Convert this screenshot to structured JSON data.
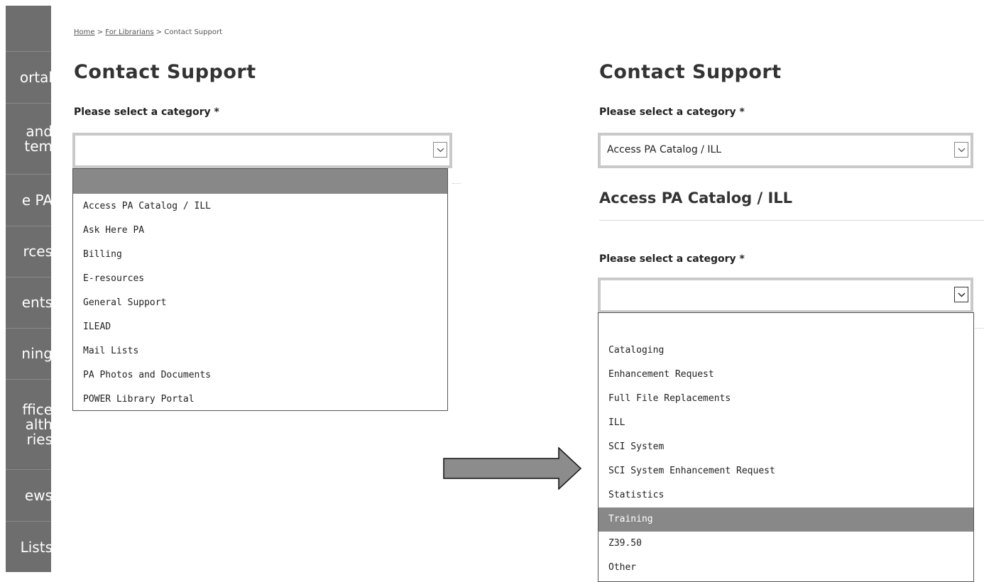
{
  "sidebar": {
    "items": [
      {
        "label": "ortal"
      },
      {
        "label": " and\ntem"
      },
      {
        "label": "e PA"
      },
      {
        "label": "rces"
      },
      {
        "label": "ents"
      },
      {
        "label": "ning"
      },
      {
        "label": "ffice\nalth\nries"
      },
      {
        "label": "ews"
      },
      {
        "label": "Lists"
      }
    ]
  },
  "left_panel": {
    "breadcrumb": {
      "home": "Home",
      "sep1": ">",
      "librarians": "For Librarians",
      "sep2": ">",
      "current": "Contact Support"
    },
    "title": "Contact Support",
    "category_label": "Please select a category *",
    "select_value": "",
    "options": [
      "",
      "Access PA Catalog / ILL",
      "Ask Here PA",
      "Billing",
      "E-resources",
      "General Support",
      "ILEAD",
      "Mail Lists",
      "PA Photos and Documents",
      "POWER Library Portal"
    ],
    "highlighted_option": ""
  },
  "right_panel": {
    "title": "Contact Support",
    "category_label": "Please select a category *",
    "select_value": "Access PA Catalog / ILL",
    "section_heading": "Access PA Catalog / ILL",
    "subcategory_label": "Please select a category *",
    "subselect_value": "",
    "sub_options": [
      "",
      "Cataloging",
      "Enhancement Request",
      "Full File Replacements",
      "ILL",
      "SCI System",
      "SCI System Enhancement Request",
      "Statistics",
      "Training",
      "Z39.50",
      "Other"
    ],
    "highlighted_option": "Training"
  },
  "arrow": {
    "direction": "right",
    "fill": "#8c8c8c"
  },
  "colors": {
    "sidebar_bg": "#6e6e6e",
    "highlight": "#888888",
    "select_border": "#c9c9c9"
  },
  "icons": {
    "select_arrow": "chevron-down-icon"
  }
}
